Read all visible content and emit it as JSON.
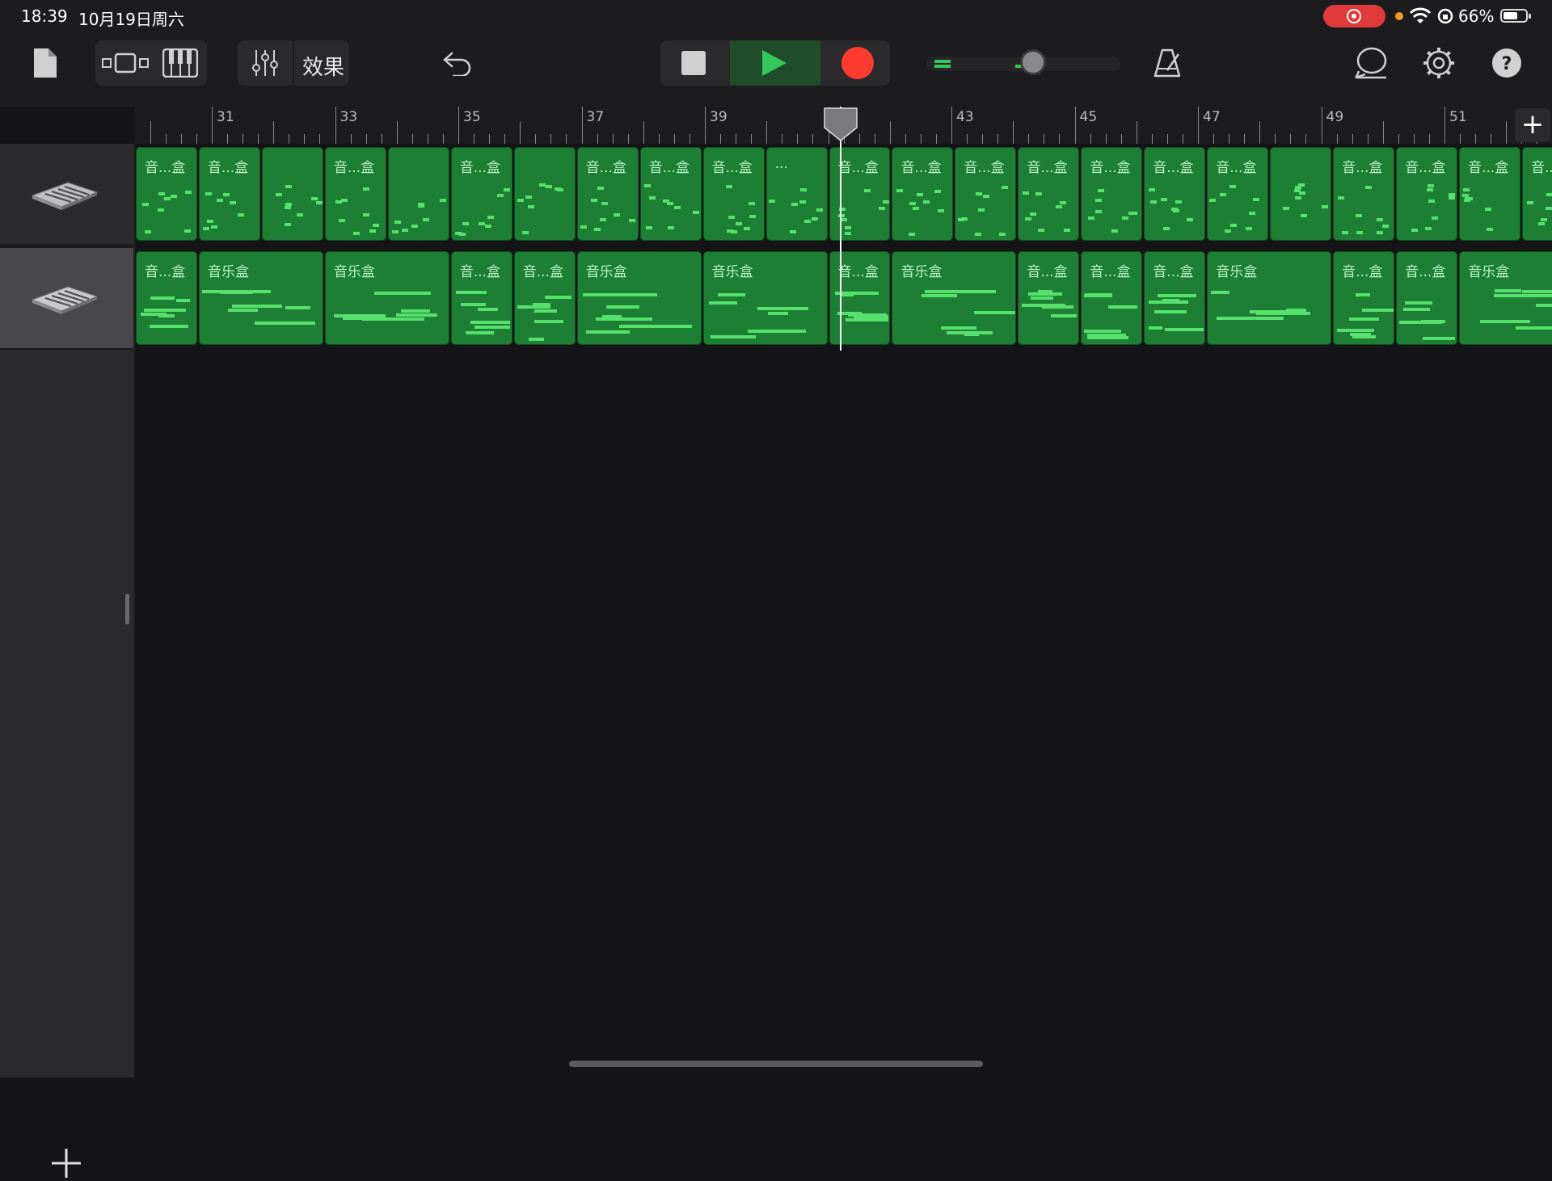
{
  "status": {
    "time": "18:39",
    "date": "10月19日周六",
    "battery_pct": "66%",
    "battery_level": 0.66,
    "recording": true
  },
  "toolbar": {
    "effects_label": "效果",
    "icons": [
      "document-icon",
      "track-view-icon",
      "keyboard-icon",
      "mixer-icon",
      "undo-icon",
      "stop-icon",
      "play-icon",
      "record-icon",
      "metronome-icon",
      "loop-icon",
      "settings-icon",
      "help-icon"
    ],
    "volume_level": 0.55,
    "colors": {
      "play_bg": "#1f4d29",
      "play": "#35c759",
      "record": "#ff3b30"
    }
  },
  "ruler": {
    "bar_numbers": [
      "31",
      "33",
      "35",
      "37",
      "39",
      "41",
      "43",
      "45",
      "47",
      "49",
      "51"
    ],
    "add_label": "+"
  },
  "playhead_bar": 41.2,
  "tracks": [
    {
      "name": "音乐盒",
      "selected": false,
      "regions": [
        {
          "label": "音...盒"
        },
        {
          "label": "音...盒"
        },
        {
          "label": ""
        },
        {
          "label": "音...盒"
        },
        {
          "label": ""
        },
        {
          "label": "音...盒"
        },
        {
          "label": ""
        },
        {
          "label": "音...盒"
        },
        {
          "label": "音...盒"
        },
        {
          "label": "音...盒"
        },
        {
          "label": "..."
        },
        {
          "label": "音...盒"
        },
        {
          "label": "音...盒"
        },
        {
          "label": "音...盒"
        },
        {
          "label": "音...盒"
        },
        {
          "label": "音...盒"
        },
        {
          "label": "音...盒"
        },
        {
          "label": "音...盒"
        },
        {
          "label": ""
        },
        {
          "label": "音...盒"
        },
        {
          "label": "音...盒"
        },
        {
          "label": "音...盒"
        },
        {
          "label": "音...盒"
        }
      ]
    },
    {
      "name": "音乐盒",
      "selected": true,
      "regions": [
        {
          "label": "音...盒"
        },
        {
          "label": "音乐盒"
        },
        {
          "label": "音乐盒"
        },
        {
          "label": "音...盒"
        },
        {
          "label": "音...盒"
        },
        {
          "label": "音乐盒"
        },
        {
          "label": "音乐盒"
        },
        {
          "label": "音...盒"
        },
        {
          "label": "音乐盒"
        },
        {
          "label": "音...盒"
        },
        {
          "label": "音...盒"
        },
        {
          "label": "音...盒"
        },
        {
          "label": "音乐盒"
        },
        {
          "label": "音...盒"
        },
        {
          "label": "音...盒"
        },
        {
          "label": "音乐盒"
        }
      ]
    }
  ],
  "sidebar": {
    "add_track_label": "+"
  }
}
